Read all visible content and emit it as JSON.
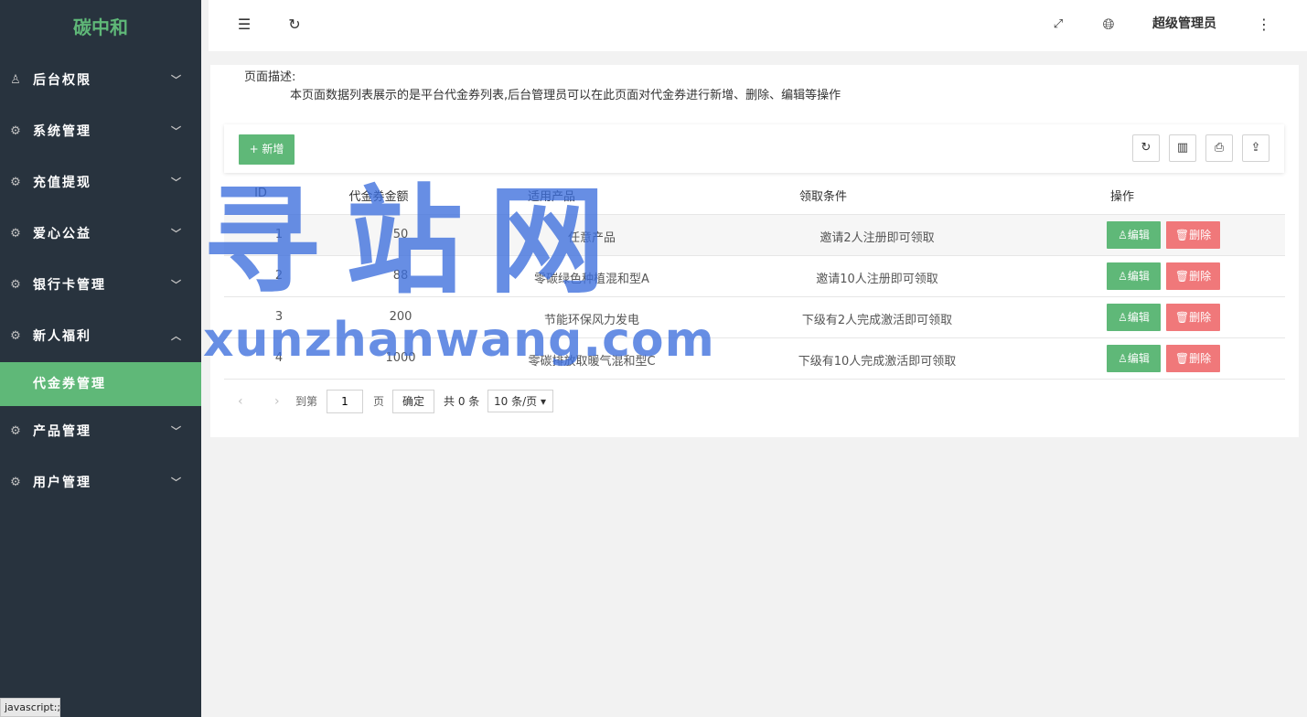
{
  "sidebar": {
    "logo": "碳中和",
    "items": [
      {
        "label": "后台权限",
        "icon": "user-icon",
        "chevron": "chevron-down-icon"
      },
      {
        "label": "系统管理",
        "icon": "gear-icon",
        "chevron": "chevron-down-icon"
      },
      {
        "label": "充值提现",
        "icon": "gear-icon",
        "chevron": "chevron-down-icon"
      },
      {
        "label": "爱心公益",
        "icon": "gear-icon",
        "chevron": "chevron-down-icon"
      },
      {
        "label": "银行卡管理",
        "icon": "gear-icon",
        "chevron": "chevron-down-icon"
      },
      {
        "label": "新人福利",
        "icon": "gear-icon",
        "chevron": "chevron-up-icon",
        "expanded": true
      },
      {
        "label": "产品管理",
        "icon": "gear-icon",
        "chevron": "chevron-down-icon"
      },
      {
        "label": "用户管理",
        "icon": "gear-icon",
        "chevron": "chevron-down-icon"
      }
    ],
    "active_sub": "代金券管理",
    "status_hint": "javascript:;"
  },
  "header": {
    "user": "超级管理员"
  },
  "description": {
    "title": "页面描述:",
    "text": "本页面数据列表展示的是平台代金券列表,后台管理员可以在此页面对代金券进行新增、删除、编辑等操作"
  },
  "toolbar": {
    "add_label": "+ 新增"
  },
  "table": {
    "headers": [
      "ID",
      "代金券金额",
      "适用产品",
      "领取条件",
      "操作"
    ],
    "rows": [
      {
        "id": "1",
        "amount": "50",
        "product": "任意产品",
        "condition": "邀请2人注册即可领取"
      },
      {
        "id": "2",
        "amount": "88",
        "product": "零碳绿色种植混和型A",
        "condition": "邀请10人注册即可领取"
      },
      {
        "id": "3",
        "amount": "200",
        "product": "节能环保风力发电",
        "condition": "下级有2人完成激活即可领取"
      },
      {
        "id": "4",
        "amount": "1000",
        "product": "零碳排放取暖气混和型C",
        "condition": "下级有10人完成激活即可领取"
      }
    ],
    "edit_label": "编辑",
    "delete_label": "删除"
  },
  "pager": {
    "goto_label": "到第",
    "page_value": "1",
    "page_unit": "页",
    "confirm_label": "确定",
    "total": "共 0 条",
    "page_size": "10 条/页"
  },
  "watermark": {
    "big": "寻站网",
    "small": "xunzhanwang.com"
  },
  "colors": {
    "sidebar_bg": "#28333e",
    "accent_green": "#5fb878",
    "danger_red": "#f0787a",
    "watermark_blue": "#3c6edc"
  }
}
